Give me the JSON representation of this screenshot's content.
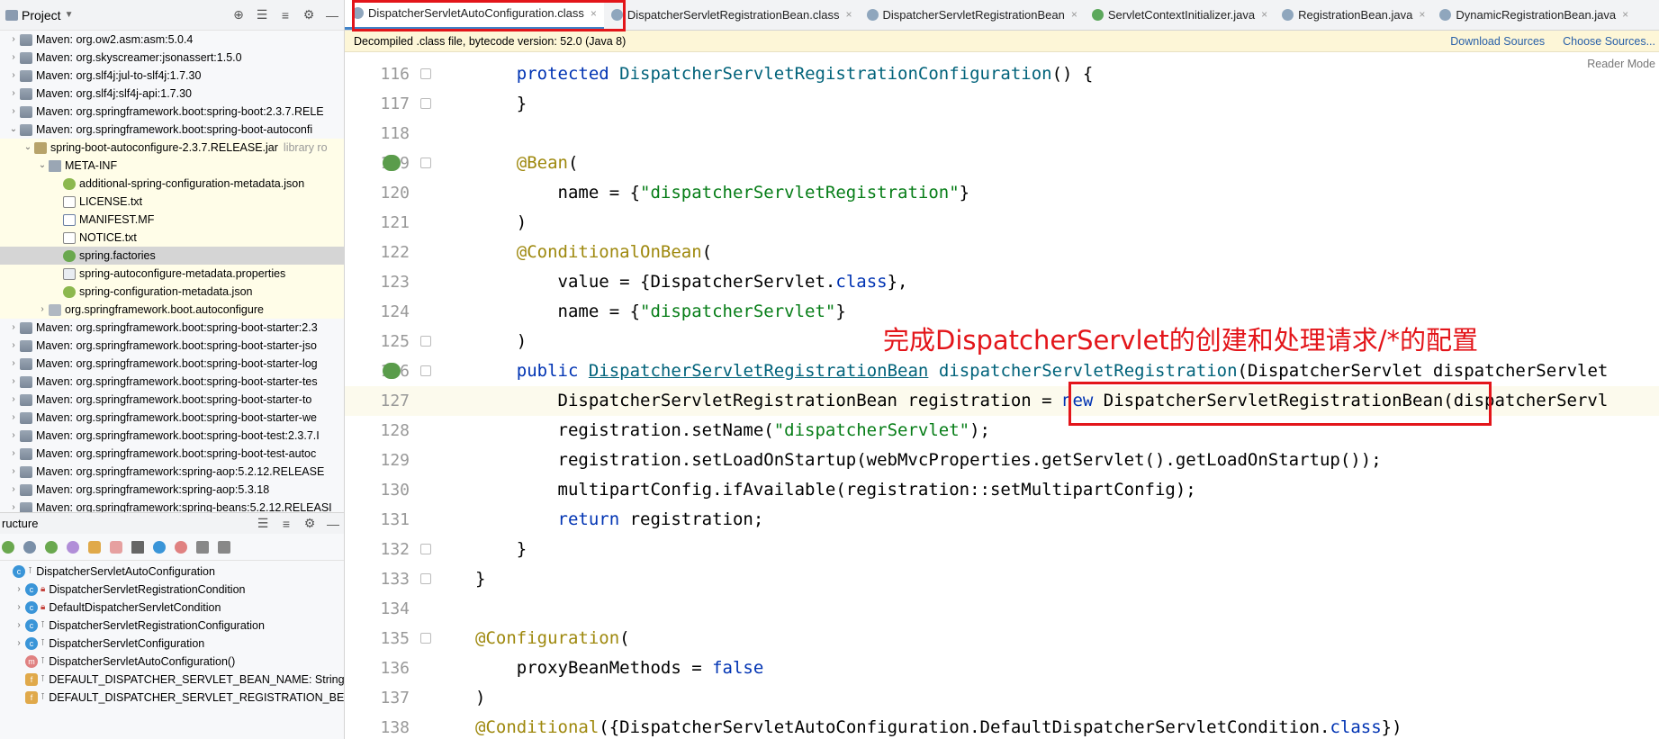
{
  "project_panel": {
    "title": "Project",
    "tree": [
      {
        "label": "Maven: org.ow2.asm:asm:5.0.4",
        "indent": 0,
        "arrow": "›",
        "icon": "lib",
        "hl": false
      },
      {
        "label": "Maven: org.skyscreamer:jsonassert:1.5.0",
        "indent": 0,
        "arrow": "›",
        "icon": "lib",
        "hl": false
      },
      {
        "label": "Maven: org.slf4j:jul-to-slf4j:1.7.30",
        "indent": 0,
        "arrow": "›",
        "icon": "lib",
        "hl": false
      },
      {
        "label": "Maven: org.slf4j:slf4j-api:1.7.30",
        "indent": 0,
        "arrow": "›",
        "icon": "lib",
        "hl": false
      },
      {
        "label": "Maven: org.springframework.boot:spring-boot:2.3.7.RELE",
        "indent": 0,
        "arrow": "›",
        "icon": "lib",
        "hl": false
      },
      {
        "label": "Maven: org.springframework.boot:spring-boot-autoconfi",
        "indent": 0,
        "arrow": "⌄",
        "icon": "lib",
        "hl": false
      },
      {
        "label": "spring-boot-autoconfigure-2.3.7.RELEASE.jar",
        "tag": "library ro",
        "indent": 1,
        "arrow": "⌄",
        "icon": "jar",
        "hl": true
      },
      {
        "label": "META-INF",
        "indent": 2,
        "arrow": "⌄",
        "icon": "folder",
        "hl": true
      },
      {
        "label": "additional-spring-configuration-metadata.json",
        "indent": 3,
        "arrow": "",
        "icon": "json",
        "hl": true
      },
      {
        "label": "LICENSE.txt",
        "indent": 3,
        "arrow": "",
        "icon": "txt",
        "hl": true
      },
      {
        "label": "MANIFEST.MF",
        "indent": 3,
        "arrow": "",
        "icon": "mf",
        "hl": true
      },
      {
        "label": "NOTICE.txt",
        "indent": 3,
        "arrow": "",
        "icon": "txt",
        "hl": true
      },
      {
        "label": "spring.factories",
        "indent": 3,
        "arrow": "",
        "icon": "spring",
        "hl": true,
        "selected": true
      },
      {
        "label": "spring-autoconfigure-metadata.properties",
        "indent": 3,
        "arrow": "",
        "icon": "props",
        "hl": true
      },
      {
        "label": "spring-configuration-metadata.json",
        "indent": 3,
        "arrow": "",
        "icon": "json",
        "hl": true
      },
      {
        "label": "org.springframework.boot.autoconfigure",
        "indent": 2,
        "arrow": "›",
        "icon": "pkg",
        "hl": true
      },
      {
        "label": "Maven: org.springframework.boot:spring-boot-starter:2.3",
        "indent": 0,
        "arrow": "›",
        "icon": "lib",
        "hl": false
      },
      {
        "label": "Maven: org.springframework.boot:spring-boot-starter-jso",
        "indent": 0,
        "arrow": "›",
        "icon": "lib",
        "hl": false
      },
      {
        "label": "Maven: org.springframework.boot:spring-boot-starter-log",
        "indent": 0,
        "arrow": "›",
        "icon": "lib",
        "hl": false
      },
      {
        "label": "Maven: org.springframework.boot:spring-boot-starter-tes",
        "indent": 0,
        "arrow": "›",
        "icon": "lib",
        "hl": false
      },
      {
        "label": "Maven: org.springframework.boot:spring-boot-starter-to",
        "indent": 0,
        "arrow": "›",
        "icon": "lib",
        "hl": false
      },
      {
        "label": "Maven: org.springframework.boot:spring-boot-starter-we",
        "indent": 0,
        "arrow": "›",
        "icon": "lib",
        "hl": false
      },
      {
        "label": "Maven: org.springframework.boot:spring-boot-test:2.3.7.I",
        "indent": 0,
        "arrow": "›",
        "icon": "lib",
        "hl": false
      },
      {
        "label": "Maven: org.springframework.boot:spring-boot-test-autoc",
        "indent": 0,
        "arrow": "›",
        "icon": "lib",
        "hl": false
      },
      {
        "label": "Maven: org.springframework:spring-aop:5.2.12.RELEASE",
        "indent": 0,
        "arrow": "›",
        "icon": "lib",
        "hl": false
      },
      {
        "label": "Maven: org.springframework:spring-aop:5.3.18",
        "indent": 0,
        "arrow": "›",
        "icon": "lib",
        "hl": false
      },
      {
        "label": "Maven: org.springframework:spring-beans:5.2.12.RELEASI",
        "indent": 0,
        "arrow": "›",
        "icon": "lib",
        "hl": false
      }
    ]
  },
  "structure_panel": {
    "title": "ructure",
    "items": [
      {
        "label": "DispatcherServletAutoConfiguration",
        "indent": 0,
        "arrow": "",
        "icon": "c",
        "mod": "open"
      },
      {
        "label": "DispatcherServletRegistrationCondition",
        "indent": 1,
        "arrow": "›",
        "icon": "c",
        "mod": "lock"
      },
      {
        "label": "DefaultDispatcherServletCondition",
        "indent": 1,
        "arrow": "›",
        "icon": "c",
        "mod": "lock"
      },
      {
        "label": "DispatcherServletRegistrationConfiguration",
        "indent": 1,
        "arrow": "›",
        "icon": "c",
        "mod": "open"
      },
      {
        "label": "DispatcherServletConfiguration",
        "indent": 1,
        "arrow": "›",
        "icon": "c",
        "mod": "open"
      },
      {
        "label": "DispatcherServletAutoConfiguration()",
        "indent": 1,
        "arrow": "",
        "icon": "m",
        "mod": "open"
      },
      {
        "label": "DEFAULT_DISPATCHER_SERVLET_BEAN_NAME: String =",
        "indent": 1,
        "arrow": "",
        "icon": "f",
        "mod": "open"
      },
      {
        "label": "DEFAULT_DISPATCHER_SERVLET_REGISTRATION_BEAN",
        "indent": 1,
        "arrow": "",
        "icon": "f",
        "mod": "open"
      }
    ]
  },
  "tabs": [
    {
      "label": "DispatcherServletAutoConfiguration.class",
      "icon": "c",
      "active": true,
      "boxed": true
    },
    {
      "label": "DispatcherServletRegistrationBean.class",
      "icon": "c",
      "active": false
    },
    {
      "label": "DispatcherServletRegistrationBean",
      "icon": "s",
      "active": false
    },
    {
      "label": "ServletContextInitializer.java",
      "icon": "i",
      "active": false
    },
    {
      "label": "RegistrationBean.java",
      "icon": "c",
      "active": false
    },
    {
      "label": "DynamicRegistrationBean.java",
      "icon": "c",
      "active": false
    }
  ],
  "notice": {
    "text": "Decompiled .class file, bytecode version: 52.0 (Java 8)",
    "download": "Download Sources",
    "choose": "Choose Sources..."
  },
  "reader_mode": "Reader Mode",
  "annotation": {
    "text": "完成DispatcherServlet的创建和处理请求/*的配置",
    "color": "#e3151a"
  },
  "code_lines": [
    {
      "n": "116",
      "html": "    <span class='kw'>protected</span> <span class='fn'>DispatcherServletRegistrationConfiguration</span>() {",
      "fold": true
    },
    {
      "n": "117",
      "html": "    }",
      "fold": true
    },
    {
      "n": "118",
      "html": ""
    },
    {
      "n": "119",
      "html": "    <span class='ann'>@Bean</span>(",
      "fold": true,
      "bean": true
    },
    {
      "n": "120",
      "html": "        name = {<span class='str'>\"dispatcherServletRegistration\"</span>}"
    },
    {
      "n": "121",
      "html": "    )"
    },
    {
      "n": "122",
      "html": "    <span class='ann'>@ConditionalOnBean</span>("
    },
    {
      "n": "123",
      "html": "        value = {DispatcherServlet.<span class='kw'>class</span>},"
    },
    {
      "n": "124",
      "html": "        name = {<span class='str'>\"dispatcherServlet\"</span>}"
    },
    {
      "n": "125",
      "html": "    )",
      "fold": true
    },
    {
      "n": "126",
      "html": "    <span class='kw'>public</span> <span class='link'>DispatcherServletRegistrationBean</span> <span class='fn'>dispatcherServletRegistration</span>(DispatcherServlet dispatcherServlet",
      "fold": true,
      "bean": true
    },
    {
      "n": "127",
      "html": "        DispatcherServletRegistrationBean registration = <span class='kw'>new</span> DispatcherServletRegistrationBean(dispatcherServl",
      "cur": true
    },
    {
      "n": "128",
      "html": "        registration.setName(<span class='str'>\"dispatcherServlet\"</span>);"
    },
    {
      "n": "129",
      "html": "        registration.setLoadOnStartup(webMvcProperties.getServlet().getLoadOnStartup());"
    },
    {
      "n": "130",
      "html": "        multipartConfig.ifAvailable(registration::setMultipartConfig);"
    },
    {
      "n": "131",
      "html": "        <span class='kw'>return</span> registration;"
    },
    {
      "n": "132",
      "html": "    }",
      "fold": true
    },
    {
      "n": "133",
      "html": "}",
      "fold": true
    },
    {
      "n": "134",
      "html": ""
    },
    {
      "n": "135",
      "html": "<span class='ann'>@Configuration</span>(",
      "fold": true
    },
    {
      "n": "136",
      "html": "    proxyBeanMethods = <span class='kw'>false</span>"
    },
    {
      "n": "137",
      "html": ")"
    },
    {
      "n": "138",
      "html": "<span class='ann'>@Conditional</span>({DispatcherServletAutoConfiguration.DefaultDispatcherServletCondition.<span class='kw'>class</span>})"
    }
  ]
}
